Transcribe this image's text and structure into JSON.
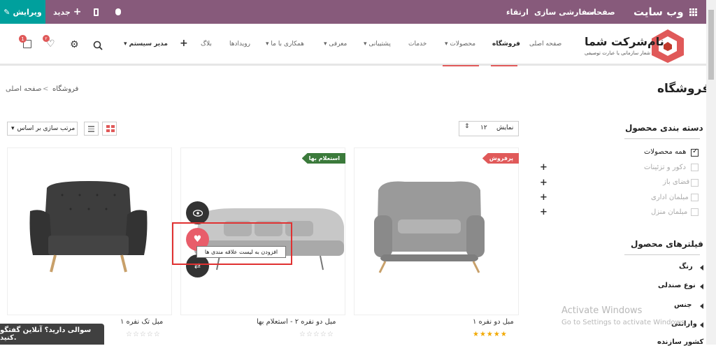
{
  "topbar": {
    "edit_label": "ویرایش",
    "new_label": "جدید",
    "upgrade": "ارتقاء",
    "customize": "سفارشی سازی",
    "pages": "صفحات",
    "site_title": "وب سایت"
  },
  "logo": {
    "name": "نام‌شرکت شما",
    "tagline": "شعار سازمانی یا عبارت توصیفی"
  },
  "nav": {
    "items": [
      "صفحه اصلی",
      "فروشگاه",
      "محصولات",
      "خدمات",
      "پشتیبانی",
      "معرفی",
      "همکاری با ما",
      "رویدادها",
      "بلاگ"
    ],
    "admin": "مدیر سیستم",
    "cart_count": "1",
    "wishlist_count": "۲"
  },
  "breadcrumb": {
    "home": "صفحه اصلی",
    "current": "فروشگاه"
  },
  "page_title": "فروشگاه",
  "toolbar": {
    "show_label": "نمایش",
    "show_value": "۱۲",
    "sort_label": "مرتب سازی بر اساس"
  },
  "sidebar": {
    "categories_title": "دسته بندی محصول",
    "categories": [
      "همه محصولات",
      "دکور و تزئینات",
      "فضای باز",
      "مبلمان اداری",
      "مبلمان منزل"
    ],
    "filters_title": "فیلترهای محصول",
    "filters": [
      "رنگ",
      "نوع صندلی",
      "جنس",
      "وارانتی",
      "کشور سازنده"
    ]
  },
  "products": [
    {
      "name": "مبل دو نفره ۱",
      "badge": "پرفروش",
      "badge_color": "#e05959",
      "stars": "★★★★★",
      "rating": 5
    },
    {
      "name": "مبل دو نفره ۲ - استعلام بها",
      "badge": "استعلام بها",
      "badge_color": "#3b7a3b",
      "stars": "☆☆☆☆☆",
      "rating": 0
    },
    {
      "name": "مبل تک نفره ۱",
      "badge": "",
      "stars": "☆☆☆☆☆",
      "rating": 0
    }
  ],
  "tooltip": "افزودن به لیست علاقه مندی ها",
  "chat": "سوالی دارید؟ آنلاین گفتگو کنید.",
  "watermark": {
    "line1": "Activate Windows",
    "line2": "Go to Settings to activate Windows."
  },
  "colors": {
    "topbar": "#875a7b",
    "edit": "#00a09d",
    "accent": "#e05959",
    "wishlist": "#e85d6a"
  },
  "icons": [
    "grid-icon",
    "bug-icon",
    "mobile-icon",
    "plus-icon",
    "pencil-icon",
    "search-icon",
    "gear-icon",
    "heart-icon",
    "cart-icon",
    "eye-icon",
    "compare-icon",
    "list-view-icon",
    "grid-view-icon",
    "check-icon"
  ]
}
